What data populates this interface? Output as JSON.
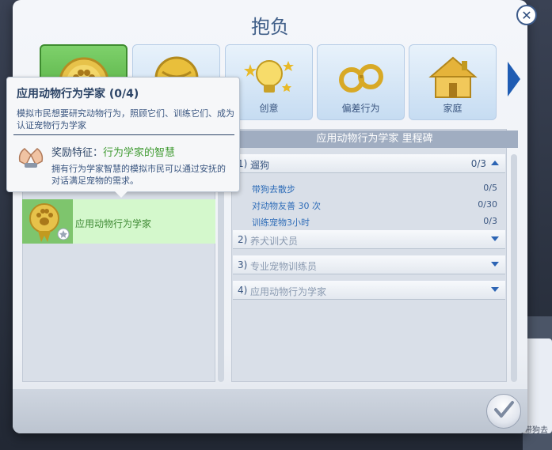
{
  "dialog": {
    "title": "抱负"
  },
  "categories": [
    {
      "label": "",
      "icon": "paw-medal-icon"
    },
    {
      "label": "",
      "icon": "gold-ball-icon"
    },
    {
      "label": "创意",
      "icon": "lightbulb-icon"
    },
    {
      "label": "偏差行为",
      "icon": "handcuffs-icon"
    },
    {
      "label": "家庭",
      "icon": "house-icon"
    }
  ],
  "aspiration_list": {
    "items": [
      {
        "label": "应用动物行为学家",
        "icon": "paw-medal-icon"
      }
    ]
  },
  "milestones": {
    "header": "应用动物行为学家 里程碑",
    "sections": [
      {
        "num": "1)",
        "name": "遛狗",
        "progress": "0/3",
        "tasks": [
          {
            "label": "带狗去散步",
            "count": "0/5"
          },
          {
            "label": "对动物友善 30 次",
            "count": "0/30"
          },
          {
            "label": "训练宠物3小时",
            "count": "0/3"
          }
        ]
      },
      {
        "num": "2)",
        "name": "养犬训犬员"
      },
      {
        "num": "3)",
        "name": "专业宠物训练员"
      },
      {
        "num": "4)",
        "name": "应用动物行为学家"
      }
    ]
  },
  "tooltip": {
    "title": "应用动物行为学家 (0/4)",
    "description": "模拟市民想要研究动物行为，照顾它们、训练它们、成为认证宠物行为学家",
    "reward_label": "奖励特征",
    "reward_sep": "：",
    "reward_name": "行为学家的智慧",
    "reward_desc": "拥有行为学家智慧的模拟市民可以通过安抚的对话满足宠物的需求。"
  },
  "background": {
    "thumb_text": "带狗去"
  },
  "colors": {
    "accent_blue": "#2c64b4",
    "selected_green": "#47a235",
    "reward_green": "#3e9a30"
  }
}
